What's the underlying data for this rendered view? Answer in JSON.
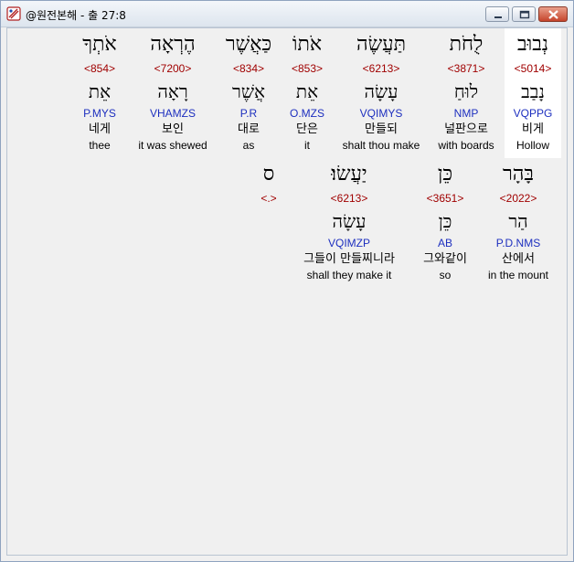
{
  "window": {
    "title": "@원전본해 - 출 27:8",
    "icon": "app-book-icon"
  },
  "row1": [
    {
      "hebrew": "נְבוּב",
      "strong": "<5014>",
      "lemma": "נָבַב",
      "morph": "VQPPG",
      "korean": "비게",
      "english": "Hollow",
      "selected": true
    },
    {
      "hebrew": "לֻחֹת",
      "strong": "<3871>",
      "lemma": "לוּחַ",
      "morph": "NMP",
      "korean": "널판으로",
      "english": "with boards"
    },
    {
      "hebrew": "תַּעֲשֶׂה",
      "strong": "<6213>",
      "lemma": "עָשָׂה",
      "morph": "VQIMYS",
      "korean": "만들되",
      "english": "shalt thou make"
    },
    {
      "hebrew": "אֹתוֹ",
      "strong": "<853>",
      "lemma": "אֵת",
      "morph": "O.MZS",
      "korean": "단은",
      "english": "it"
    },
    {
      "hebrew": "כַּאֲשֶׁר",
      "strong": "<834>",
      "lemma": "אֲשֶׁר",
      "morph": "P.R",
      "korean": "대로",
      "english": "as"
    },
    {
      "hebrew": "הֶרְאָה",
      "strong": "<7200>",
      "lemma": "רָאָה",
      "morph": "VHAMZS",
      "korean": "보인",
      "english": "it was shewed"
    },
    {
      "hebrew": "אֹתְךָ",
      "strong": "<854>",
      "lemma": "אֵת",
      "morph": "P.MYS",
      "korean": "네게",
      "english": "thee"
    }
  ],
  "row2": [
    {
      "hebrew": "בָּהָר",
      "strong": "<2022>",
      "lemma": "הַר",
      "morph": "P.D.NMS",
      "korean": "산에서",
      "english": "in the mount"
    },
    {
      "hebrew": "כֵּן",
      "strong": "<3651>",
      "lemma": "כֵּן",
      "morph": "AB",
      "korean": "그와같이",
      "english": "so"
    },
    {
      "hebrew": "יַעֲשׂוּ׃",
      "strong": "<6213>",
      "lemma": "עָשָׂה",
      "morph": "VQIMZP",
      "korean": "그들이 만들찌니라",
      "english": "shall they make it"
    },
    {
      "hebrew": "ס",
      "strong": "<.>"
    }
  ]
}
